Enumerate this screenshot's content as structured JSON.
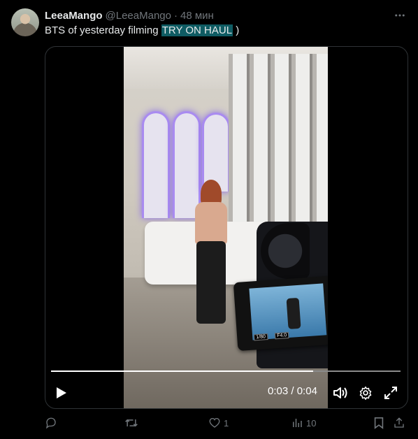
{
  "tweet": {
    "display_name": "LeeaMango",
    "handle": "@LeeaMango",
    "separator": "·",
    "time": "48 мин",
    "text_before": "BTS of yesterday filming ",
    "text_highlight": "TRY ON HAUL",
    "text_after": " )"
  },
  "video": {
    "current_time": "0:03",
    "separator": " / ",
    "duration": "0:04",
    "progress": 0.75,
    "camera_screen": {
      "shutter": "1/80",
      "aperture": "F4.0"
    }
  },
  "actions": {
    "reply_count": "",
    "retweet_count": "",
    "like_count": "1",
    "views_count": "10"
  },
  "icons": {
    "more": "more-icon",
    "play": "play-icon",
    "volume": "volume-icon",
    "settings": "gear-icon",
    "fullscreen": "fullscreen-icon",
    "reply": "reply-icon",
    "retweet": "retweet-icon",
    "like": "heart-icon",
    "views": "views-icon",
    "bookmark": "bookmark-icon",
    "share": "share-icon"
  },
  "colors": {
    "background": "#000000",
    "text": "#e7e9ea",
    "muted": "#71767b",
    "highlight": "#0f5c63",
    "arch_glow": "#a98bf0"
  }
}
